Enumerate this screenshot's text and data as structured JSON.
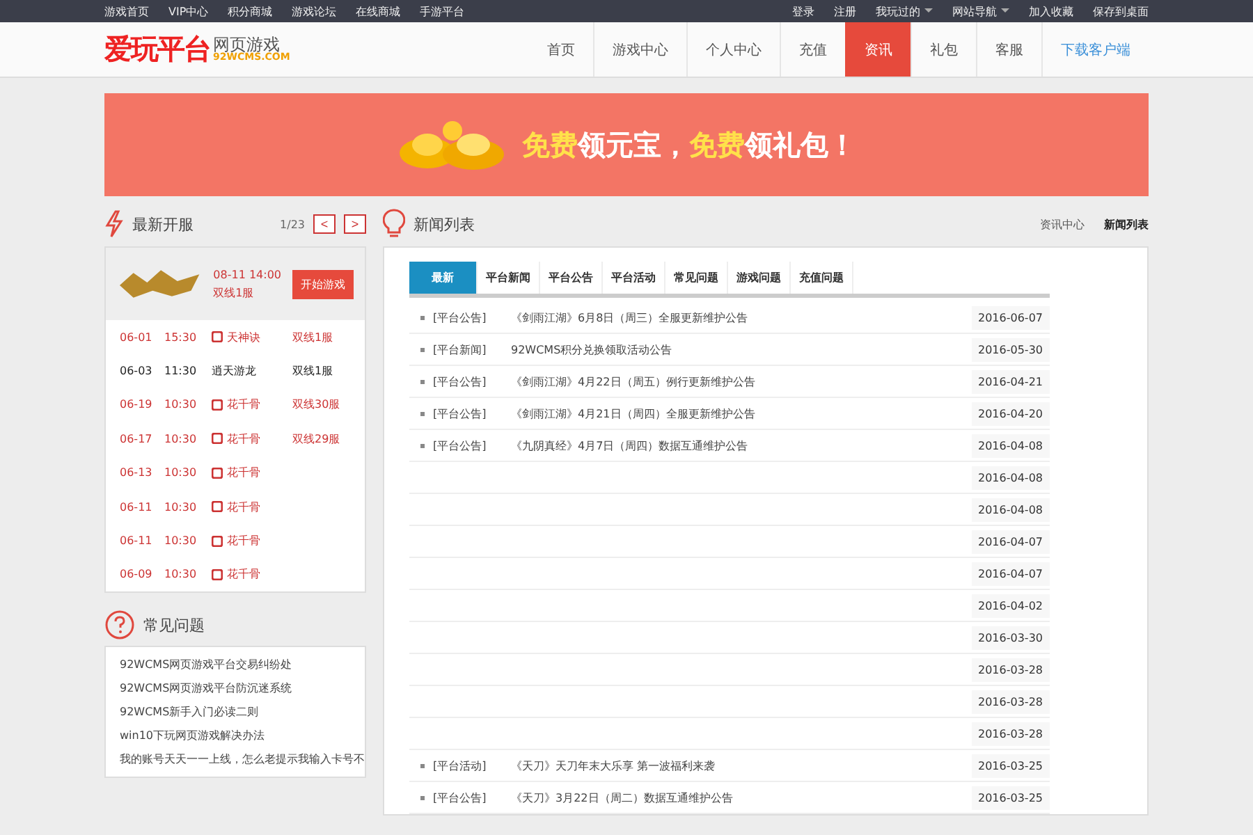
{
  "top_links": {
    "left": [
      "游戏首页",
      "VIP中心",
      "积分商城",
      "游戏论坛",
      "在线商城",
      "手游平台"
    ],
    "right": [
      {
        "label": "登录",
        "dropdown": false
      },
      {
        "label": "注册",
        "dropdown": false
      },
      {
        "label": "我玩过的",
        "dropdown": true
      },
      {
        "label": "网站导航",
        "dropdown": true
      },
      {
        "label": "加入收藏",
        "dropdown": false
      },
      {
        "label": "保存到桌面",
        "dropdown": false
      }
    ]
  },
  "logo": {
    "main": "爱玩平台",
    "sub": "网页游戏",
    "domain": "92WCMS.COM"
  },
  "nav": [
    {
      "label": "首页",
      "selected": false,
      "kind": "link"
    },
    {
      "label": "游戏中心",
      "selected": false,
      "kind": "link"
    },
    {
      "label": "个人中心",
      "selected": false,
      "kind": "link"
    },
    {
      "label": "充值",
      "selected": false,
      "kind": "link"
    },
    {
      "label": "资讯",
      "selected": true,
      "kind": "link"
    },
    {
      "label": "礼包",
      "selected": false,
      "kind": "link"
    },
    {
      "label": "客服",
      "selected": false,
      "kind": "link"
    },
    {
      "label": "下载客户端",
      "selected": false,
      "kind": "download"
    }
  ],
  "banner": {
    "text": "**免费**领元宝，**免费**领礼包！"
  },
  "servers": {
    "title": "最新开服",
    "page": "1/23",
    "prev": "<",
    "next": ">",
    "featured": {
      "time": "08-11 14:00",
      "server": "双线1服",
      "button": "开始游戏"
    },
    "rows": [
      {
        "date": "06-01",
        "time": "15:30",
        "game": "天神诀",
        "server": "双线1服",
        "highlight": true
      },
      {
        "date": "06-03",
        "time": "11:30",
        "game": "逍天游龙",
        "server": "双线1服",
        "highlight": false
      },
      {
        "date": "06-19",
        "time": "10:30",
        "game": "花千骨",
        "server": "双线30服",
        "highlight": true
      },
      {
        "date": "06-17",
        "time": "10:30",
        "game": "花千骨",
        "server": "双线29服",
        "highlight": true
      },
      {
        "date": "06-13",
        "time": "10:30",
        "game": "花千骨",
        "highlight": true
      },
      {
        "date": "06-11",
        "time": "10:30",
        "game": "花千骨",
        "highlight": true
      },
      {
        "date": "06-11",
        "time": "10:30",
        "game": "花千骨",
        "highlight": true
      },
      {
        "date": "06-09",
        "time": "10:30",
        "game": "花千骨",
        "highlight": true
      }
    ]
  },
  "faq": {
    "title": "常见问题",
    "items": [
      "92WCMS网页游戏平台交易纠纷处",
      "92WCMS网页游戏平台防沉迷系统",
      "92WCMS新手入门必读二则",
      "win10下玩网页游戏解决办法",
      "我的账号天天一一上线，怎么老提示我输入卡号不"
    ]
  },
  "news": {
    "title": "新闻列表",
    "breadcrumb": [
      "资讯中心",
      "新闻列表"
    ],
    "tabs": [
      {
        "label": "最新",
        "selected": true
      },
      {
        "label": "平台新闻",
        "selected": false
      },
      {
        "label": "平台公告",
        "selected": false
      },
      {
        "label": "平台活动",
        "selected": false
      },
      {
        "label": "常见问题",
        "selected": false
      },
      {
        "label": "游戏问题",
        "selected": false
      },
      {
        "label": "充值问题",
        "selected": false
      }
    ],
    "rows": [
      {
        "category": "[平台公告]",
        "title": "《剑雨江湖》6月8日（周三）全服更新维护公告",
        "date": "2016-06-07"
      },
      {
        "category": "[平台新闻]",
        "title": "92WCMS积分兑换领取活动公告",
        "date": "2016-05-30"
      },
      {
        "category": "[平台公告]",
        "title": "《剑雨江湖》4月22日（周五）例行更新维护公告",
        "date": "2016-04-21"
      },
      {
        "category": "[平台公告]",
        "title": "《剑雨江湖》4月21日（周四）全服更新维护公告",
        "date": "2016-04-20"
      },
      {
        "category": "[平台公告]",
        "title": "《九阴真经》4月7日（周四）数据互通维护公告",
        "date": "2016-04-08"
      },
      {
        "date": "2016-04-08"
      },
      {
        "date": "2016-04-08"
      },
      {
        "date": "2016-04-07"
      },
      {
        "date": "2016-04-07"
      },
      {
        "date": "2016-04-02"
      },
      {
        "date": "2016-03-30"
      },
      {
        "date": "2016-03-28"
      },
      {
        "date": "2016-03-28"
      },
      {
        "date": "2016-03-28"
      },
      {
        "category": "[平台活动]",
        "title": "《天刀》天刀年末大乐享 第一波福利来袭",
        "date": "2016-03-25"
      },
      {
        "category": "[平台公告]",
        "title": "《天刀》3月22日（周二）数据互通维护公告",
        "date": "2016-03-25"
      }
    ]
  }
}
